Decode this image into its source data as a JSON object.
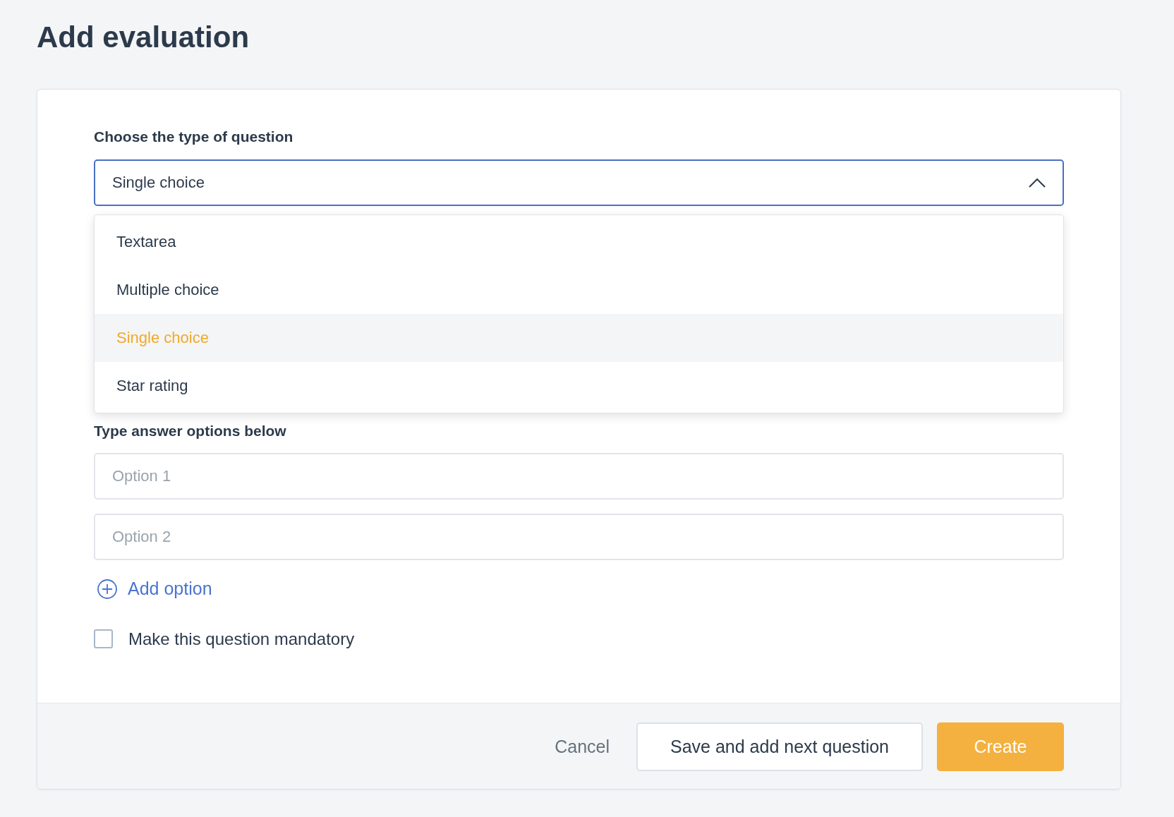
{
  "page": {
    "title": "Add evaluation"
  },
  "question_type": {
    "label": "Choose the type of question",
    "value": "Single choice",
    "expanded": true,
    "options": [
      {
        "label": "Textarea",
        "selected": false
      },
      {
        "label": "Multiple choice",
        "selected": false
      },
      {
        "label": "Single choice",
        "selected": true
      },
      {
        "label": "Star rating",
        "selected": false
      }
    ]
  },
  "answers": {
    "label": "Type answer options below",
    "fields": [
      {
        "placeholder": "Option 1"
      },
      {
        "placeholder": "Option 2"
      }
    ],
    "add_option": "Add option"
  },
  "mandatory": {
    "label": "Make this question mandatory",
    "checked": false
  },
  "footer": {
    "cancel": "Cancel",
    "save_next": "Save and add next question",
    "create": "Create"
  }
}
